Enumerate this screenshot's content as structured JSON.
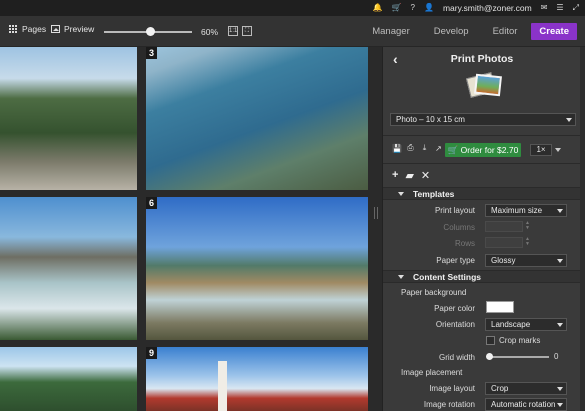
{
  "topbar": {
    "icons": [
      "bell-icon",
      "cart-icon",
      "help-icon",
      "user-icon",
      "mail-icon",
      "menu-icon",
      "expand-icon"
    ],
    "email": "mary.smith@zoner.com"
  },
  "toolbar": {
    "pages_label": "Pages",
    "preview_label": "Preview",
    "zoom": "60%",
    "zoom_fraction": 0.5
  },
  "modes": {
    "manager": "Manager",
    "develop": "Develop",
    "editor": "Editor",
    "create": "Create",
    "accent": "#8a33c9"
  },
  "grid": {
    "numbers": {
      "p3": "3",
      "p6": "6",
      "p9": "9"
    }
  },
  "panel": {
    "title": "Print Photos",
    "paper_size": "Photo – 10 x 15 cm",
    "order_label": "Order for $2.70",
    "order_color": "#2f8c3f",
    "quantity": "1×",
    "templates": {
      "header": "Templates",
      "print_layout_label": "Print layout",
      "print_layout": "Maximum size",
      "columns_label": "Columns",
      "rows_label": "Rows",
      "paper_type_label": "Paper type",
      "paper_type": "Glossy"
    },
    "content": {
      "header": "Content Settings",
      "paper_background": "Paper background",
      "paper_color_label": "Paper color",
      "paper_color": "#ffffff",
      "orientation_label": "Orientation",
      "orientation": "Landscape",
      "crop_marks": "Crop marks",
      "grid_width_label": "Grid width",
      "grid_width": "0",
      "image_placement": "Image placement",
      "image_layout_label": "Image layout",
      "image_layout": "Crop",
      "image_rotation_label": "Image rotation",
      "image_rotation": "Automatic rotation"
    }
  }
}
